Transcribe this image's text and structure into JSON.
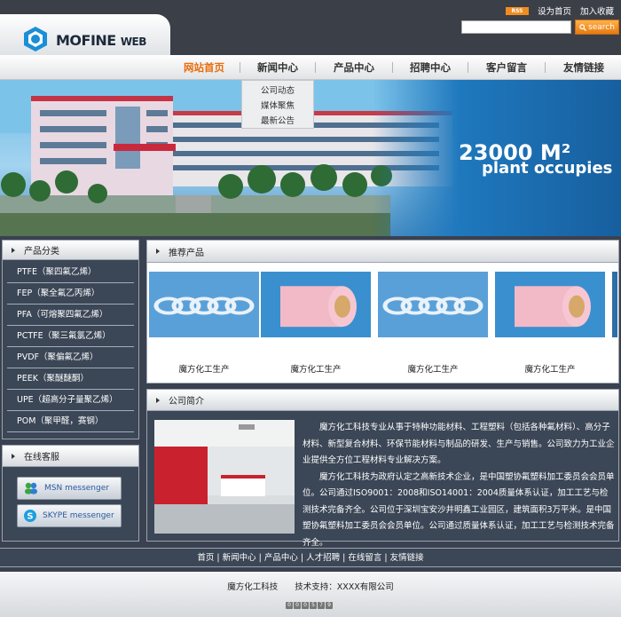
{
  "header": {
    "logo_main": "MOFINE",
    "logo_sub": "WEB",
    "rss": "RSS",
    "set_home": "设为首页",
    "add_fav": "加入收藏",
    "search_placeholder": "",
    "search_button": "search"
  },
  "nav": {
    "items": [
      {
        "label": "网站首页"
      },
      {
        "label": "新闻中心"
      },
      {
        "label": "产品中心"
      },
      {
        "label": "招聘中心"
      },
      {
        "label": "客户留言"
      },
      {
        "label": "友情链接"
      }
    ],
    "dropdown": [
      "公司动态",
      "媒体聚焦",
      "最新公告"
    ]
  },
  "banner": {
    "headline": "23000 M²",
    "subline": "plant occupies"
  },
  "sidebar": {
    "categories_title": "产品分类",
    "categories": [
      "PTFE（聚四氟乙烯）",
      "FEP（聚全氟乙丙烯）",
      "PFA（可熔聚四氟乙烯）",
      "PCTFE（聚三氟氯乙烯）",
      "PVDF（聚偏氟乙烯）",
      "PEEK（聚醚醚酮）",
      "UPE（超高分子量聚乙烯）",
      "POM（聚甲醛，赛钢）"
    ],
    "service_title": "在线客服",
    "msn": "MSN messenger",
    "skype": "SKYPE messenger"
  },
  "products": {
    "title": "推荐产品",
    "items": [
      {
        "caption": "魔方化工生产",
        "kind": "rings"
      },
      {
        "caption": "魔方化工生产",
        "kind": "roll"
      },
      {
        "caption": "魔方化工生产",
        "kind": "rings"
      },
      {
        "caption": "魔方化工生产",
        "kind": "roll"
      }
    ]
  },
  "intro": {
    "title": "公司简介",
    "p1": "魔方化工科技专业从事于特种功能材料、工程塑料（包括各种氟材料）、高分子材料、新型复合材料、环保节能材料与制品的研发、生产与销售。公司致力为工业企业提供全方位工程材料专业解决方案。",
    "p2": "魔方化工科技为政府认定之高新技术企业，是中国塑协氟塑料加工委员会会员单位。公司通过ISO9001：2008和ISO14001：2004质量体系认证，加工工艺与检测技术完备齐全。公司位于深圳宝安沙井明鑫工业园区，建筑面积3万平米。是中国塑协氟塑料加工委员会会员单位。公司通过质量体系认证，加工工艺与检测技术完备齐全。"
  },
  "footer": {
    "links": "首页 | 新闻中心 | 产品中心 | 人才招聘 | 在线留言 | 友情链接",
    "copyright": "魔方化工科技　　技术支持：XXXX有限公司",
    "counter": [
      "0",
      "0",
      "0",
      "5",
      "7",
      "9"
    ]
  },
  "colors": {
    "accent": "#e96c0b",
    "panel": "#3b4656",
    "header": "#3b3f48"
  }
}
